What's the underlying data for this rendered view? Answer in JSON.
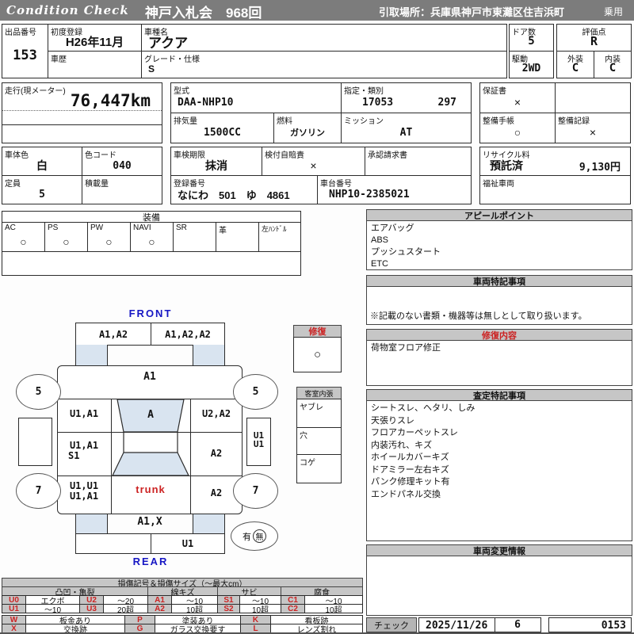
{
  "colors": {
    "accent_fill": "#d9e4f0",
    "label_blue": "#1717c4",
    "warn_red": "#cc2222",
    "bar_gray": "#7c7c7c"
  },
  "header": {
    "brand": "Condition  Check",
    "auction": "神戸入札会　968回",
    "pickup": "引取場所：兵庫県神戸市東灘区住吉浜町",
    "vehicle_class": "乗用"
  },
  "info": {
    "lot_label": "出品番号",
    "lot_no": "153",
    "first_reg_label": "初度登録",
    "first_reg": "H26年11月",
    "history_label": "車歴",
    "history": "",
    "model_label": "車種名",
    "model": "アクア",
    "grade_label": "グレード・仕様",
    "grade": "S",
    "doors_label": "ドア数",
    "doors": "5",
    "score_label": "評価点",
    "score": "R",
    "drive_label": "駆動",
    "drive": "2WD",
    "exterior_label": "外装",
    "exterior": "C",
    "interior_label": "内装",
    "interior": "C",
    "mileage_label": "走行(現メーター)",
    "mileage": "76,447km",
    "model_code_label": "型式",
    "model_code": "DAA-NHP10",
    "class_label": "指定・類別",
    "class_no1": "17053",
    "class_no2": "297",
    "displacement_label": "排気量",
    "displacement": "1500CC",
    "fuel_label": "燃料",
    "fuel": "ガソリン",
    "mission_label": "ミッション",
    "mission": "AT",
    "warranty_label": "保証書",
    "warranty": "×",
    "maintenance_book_label": "整備手帳",
    "maintenance_book": "○",
    "maintenance_record_label": "整備記録",
    "maintenance_record": "×",
    "body_color_label": "車体色",
    "body_color": "白",
    "color_code_label": "色コード",
    "color_code": "040",
    "inspection_label": "車検期限",
    "inspection": "抹消",
    "insurance_label": "検付自賠責",
    "insurance": "×",
    "approval_label": "承認請求書",
    "approval": "",
    "capacity_label": "定員",
    "capacity": "5",
    "load_label": "積載量",
    "load": "",
    "reg_no_label": "登録番号",
    "reg_no": "なにわ　501　ゆ　4861",
    "chassis_label": "車台番号",
    "chassis": "NHP10-2385021",
    "recycle_label": "リサイクル料",
    "recycle_status": "預託済",
    "recycle_fee": "9,130円",
    "welfare_label": "福祉車両",
    "welfare": ""
  },
  "equipment": {
    "title": "装備",
    "items": [
      {
        "label": "AC",
        "value": "○"
      },
      {
        "label": "PS",
        "value": "○"
      },
      {
        "label": "PW",
        "value": "○"
      },
      {
        "label": "NAVI",
        "value": "○"
      },
      {
        "label": "SR",
        "value": ""
      },
      {
        "label": "革",
        "value": ""
      },
      {
        "label": "左ﾊﾝﾄﾞﾙ",
        "value": ""
      }
    ]
  },
  "diagram": {
    "front_label": "FRONT",
    "rear_label": "REAR",
    "front_bumper_left": "A1,A2",
    "front_bumper_right": "A1,A2,A2",
    "hood": "A1",
    "left_fender": "U1,A1",
    "windshield": "A",
    "right_fender": "U2,A2",
    "left_door1": "U1,A1",
    "left_door2": "S1",
    "right_door": "A2",
    "left_quarter1": "U1,U1",
    "left_quarter2": "U1,A1",
    "right_quarter": "A2",
    "trunk": "trunk",
    "rear_panel": "A1,X",
    "rear_under": "U1",
    "right_sill1": "U1",
    "right_sill2": "U1",
    "wheel_fl": "5",
    "wheel_fr": "5",
    "wheel_rl": "7",
    "wheel_rr": "7",
    "spare_yes": "有",
    "spare_no": "無",
    "repair_box_title": "修復",
    "repair_box_value": "○",
    "cabin_box_title": "客室内張",
    "cabin_row1": "ヤブレ",
    "cabin_row2": "穴",
    "cabin_row3": "コゲ"
  },
  "panels": {
    "appeal": {
      "title": "アピールポイント",
      "lines": [
        "エアバッグ",
        "ABS",
        "プッシュスタート",
        "ETC"
      ]
    },
    "notes": {
      "title": "車両特記事項",
      "footnote": "※記載のない書類・機器等は無しとして取り扱います。"
    },
    "repair": {
      "title": "修復内容",
      "lines": [
        "荷物室フロア修正"
      ]
    },
    "assessment": {
      "title": "査定特記事項",
      "lines": [
        "シートスレ、ヘタリ、しみ",
        "天張りスレ",
        "フロアカーペットスレ",
        "内装汚れ、キズ",
        "ホイールカバーキズ",
        "ドアミラー左右キズ",
        "パンク修理キット有",
        "エンドパネル交換"
      ]
    },
    "changes": {
      "title": "車両変更情報"
    },
    "check": {
      "label": "チェック",
      "date": "2025/11/26",
      "num": "6",
      "code": "0153"
    }
  },
  "legend": {
    "title": "損傷記号＆損傷サイズ（～最大cm）",
    "groups": [
      "凸凹・亀裂",
      "線キズ",
      "サビ",
      "腐食"
    ],
    "row1": [
      "U0",
      "エクボ",
      "U2",
      "～20",
      "A1",
      "～10",
      "S1",
      "～10",
      "C1",
      "～10"
    ],
    "row2": [
      "U1",
      "～10",
      "U3",
      "20超",
      "A2",
      "10超",
      "S2",
      "10超",
      "C2",
      "10超"
    ],
    "row3": [
      "W",
      "板金あり",
      "P",
      "塗装あり",
      "K",
      "看板跡"
    ],
    "row4": [
      "X",
      "交換跡",
      "G",
      "ガラス交換要す",
      "L",
      "レンズ割れ"
    ]
  }
}
